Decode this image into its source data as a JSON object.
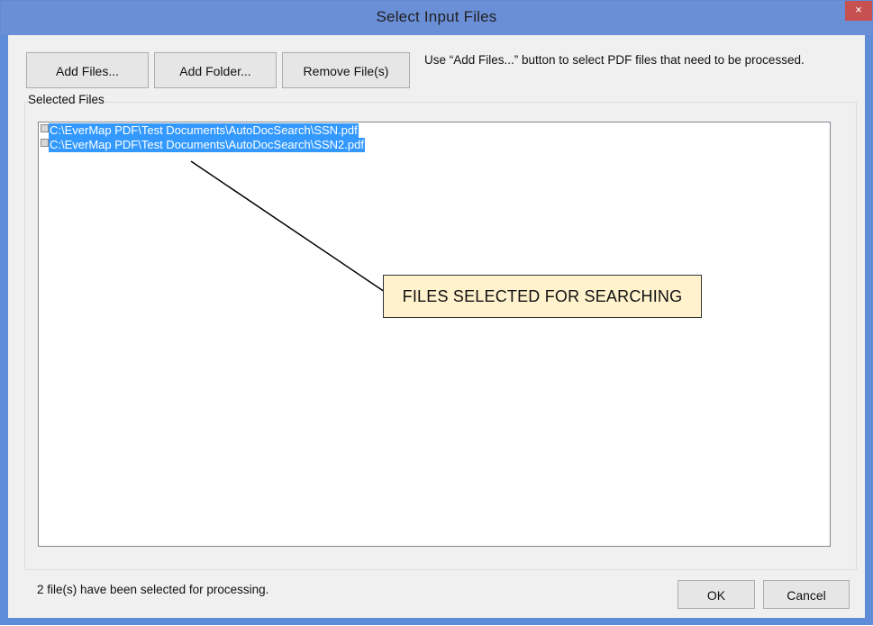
{
  "window": {
    "title": "Select Input Files",
    "close_label": "×"
  },
  "toolbar": {
    "add_files_label": "Add Files...",
    "add_folder_label": "Add Folder...",
    "remove_files_label": "Remove File(s)",
    "hint_text": "Use “Add Files...” button to select PDF files that need to be processed."
  },
  "selected_files": {
    "group_label": "Selected Files",
    "items": [
      "C:\\EverMap PDF\\Test Documents\\AutoDocSearch\\SSN.pdf",
      "C:\\EverMap PDF\\Test Documents\\AutoDocSearch\\SSN2.pdf"
    ]
  },
  "annotation": {
    "callout_text": "FILES SELECTED FOR SEARCHING"
  },
  "footer": {
    "status_text": "2 file(s) have been selected for processing.",
    "ok_label": "OK",
    "cancel_label": "Cancel"
  },
  "colors": {
    "titlebar": "#6b8fd6",
    "close_button": "#c75050",
    "selection": "#3399ff",
    "callout_fill": "#fff2cc"
  }
}
